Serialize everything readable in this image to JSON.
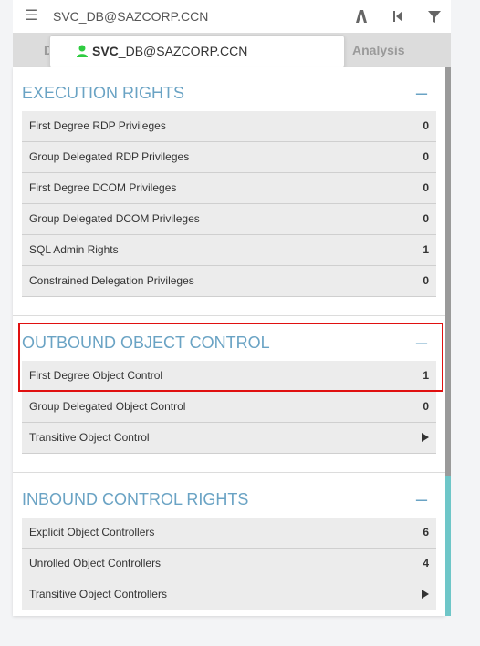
{
  "search": {
    "value": "SVC_DB@SAZCORP.CCN"
  },
  "tabs": [
    {
      "label": "D"
    },
    {
      "label": ""
    },
    {
      "label": "Analysis"
    }
  ],
  "autocomplete": {
    "bold": "SVC",
    "rest": "_DB@SAZCORP.CCN"
  },
  "execution": {
    "title": "EXECUTION RIGHTS",
    "rows": [
      {
        "label": "First Degree RDP Privileges",
        "value": "0"
      },
      {
        "label": "Group Delegated RDP Privileges",
        "value": "0"
      },
      {
        "label": "First Degree DCOM Privileges",
        "value": "0"
      },
      {
        "label": "Group Delegated DCOM Privileges",
        "value": "0"
      },
      {
        "label": "SQL Admin Rights",
        "value": "1"
      },
      {
        "label": "Constrained Delegation Privileges",
        "value": "0"
      }
    ]
  },
  "outbound": {
    "title": "OUTBOUND OBJECT CONTROL",
    "rows": [
      {
        "label": "First Degree Object Control",
        "value": "1"
      },
      {
        "label": "Group Delegated Object Control",
        "value": "0"
      },
      {
        "label": "Transitive Object Control",
        "value": ""
      }
    ]
  },
  "inbound": {
    "title": "INBOUND CONTROL RIGHTS",
    "rows": [
      {
        "label": "Explicit Object Controllers",
        "value": "6"
      },
      {
        "label": "Unrolled Object Controllers",
        "value": "4"
      },
      {
        "label": "Transitive Object Controllers",
        "value": ""
      }
    ]
  },
  "colors": {
    "accent": "#6aa3c4",
    "highlight": "#e01010",
    "user_icon": "#2ecc40"
  },
  "icons": [
    "menu-icon",
    "path-icon",
    "back-icon",
    "filter-icon",
    "user-icon",
    "collapse-icon",
    "expand-arrow-icon"
  ]
}
